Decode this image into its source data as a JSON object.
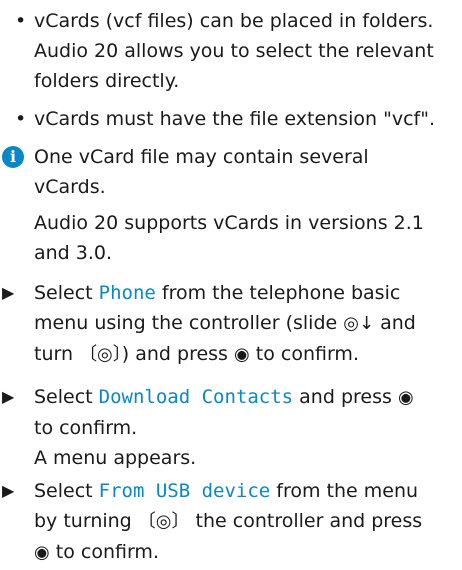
{
  "bullets": [
    {
      "line1": "vCards (vcf files) can be placed in folders.",
      "line2": "Audio 20 allows you to select the relevant",
      "line3": "folders directly."
    },
    {
      "line1": "vCards must have the file extension \"vcf\"."
    }
  ],
  "note": {
    "line1": "One vCard file may contain several",
    "line2": "vCards.",
    "line3": "Audio 20 supports vCards in versions 2.1",
    "line4": "and 3.0."
  },
  "steps": [
    {
      "pre": "Select ",
      "menu": "Phone",
      "post": " from the telephone basic",
      "line2a": "menu using the controller (slide ",
      "sym1": "◎↓",
      "line2b": " and",
      "line3a": "turn ",
      "sym2": "〔◎〕",
      "line3b": ") and press ",
      "sym3": "◉",
      "line3c": " to confirm."
    },
    {
      "pre": "Select ",
      "menu": "Download Contacts",
      "post": " and press ",
      "sym": "◉",
      "line2": "to confirm.",
      "line3": "A menu appears."
    },
    {
      "pre": "Select ",
      "menu": "From USB device",
      "post": " from the menu",
      "line2a": "by turning ",
      "sym": "〔◎〕",
      "line2b": " the controller and press",
      "sym2": "◉",
      "line3": " to confirm."
    }
  ]
}
